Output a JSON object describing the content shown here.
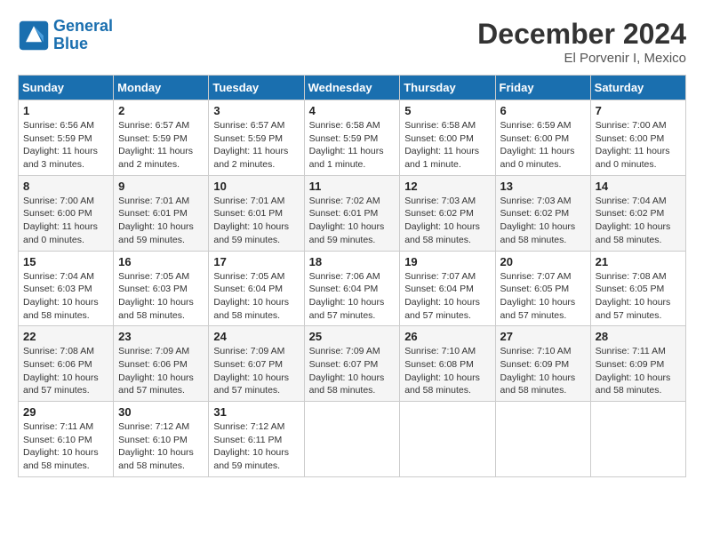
{
  "header": {
    "logo_line1": "General",
    "logo_line2": "Blue",
    "month_year": "December 2024",
    "location": "El Porvenir I, Mexico"
  },
  "weekdays": [
    "Sunday",
    "Monday",
    "Tuesday",
    "Wednesday",
    "Thursday",
    "Friday",
    "Saturday"
  ],
  "weeks": [
    [
      {
        "day": "1",
        "info": "Sunrise: 6:56 AM\nSunset: 5:59 PM\nDaylight: 11 hours\nand 3 minutes."
      },
      {
        "day": "2",
        "info": "Sunrise: 6:57 AM\nSunset: 5:59 PM\nDaylight: 11 hours\nand 2 minutes."
      },
      {
        "day": "3",
        "info": "Sunrise: 6:57 AM\nSunset: 5:59 PM\nDaylight: 11 hours\nand 2 minutes."
      },
      {
        "day": "4",
        "info": "Sunrise: 6:58 AM\nSunset: 5:59 PM\nDaylight: 11 hours\nand 1 minute."
      },
      {
        "day": "5",
        "info": "Sunrise: 6:58 AM\nSunset: 6:00 PM\nDaylight: 11 hours\nand 1 minute."
      },
      {
        "day": "6",
        "info": "Sunrise: 6:59 AM\nSunset: 6:00 PM\nDaylight: 11 hours\nand 0 minutes."
      },
      {
        "day": "7",
        "info": "Sunrise: 7:00 AM\nSunset: 6:00 PM\nDaylight: 11 hours\nand 0 minutes."
      }
    ],
    [
      {
        "day": "8",
        "info": "Sunrise: 7:00 AM\nSunset: 6:00 PM\nDaylight: 11 hours\nand 0 minutes."
      },
      {
        "day": "9",
        "info": "Sunrise: 7:01 AM\nSunset: 6:01 PM\nDaylight: 10 hours\nand 59 minutes."
      },
      {
        "day": "10",
        "info": "Sunrise: 7:01 AM\nSunset: 6:01 PM\nDaylight: 10 hours\nand 59 minutes."
      },
      {
        "day": "11",
        "info": "Sunrise: 7:02 AM\nSunset: 6:01 PM\nDaylight: 10 hours\nand 59 minutes."
      },
      {
        "day": "12",
        "info": "Sunrise: 7:03 AM\nSunset: 6:02 PM\nDaylight: 10 hours\nand 58 minutes."
      },
      {
        "day": "13",
        "info": "Sunrise: 7:03 AM\nSunset: 6:02 PM\nDaylight: 10 hours\nand 58 minutes."
      },
      {
        "day": "14",
        "info": "Sunrise: 7:04 AM\nSunset: 6:02 PM\nDaylight: 10 hours\nand 58 minutes."
      }
    ],
    [
      {
        "day": "15",
        "info": "Sunrise: 7:04 AM\nSunset: 6:03 PM\nDaylight: 10 hours\nand 58 minutes."
      },
      {
        "day": "16",
        "info": "Sunrise: 7:05 AM\nSunset: 6:03 PM\nDaylight: 10 hours\nand 58 minutes."
      },
      {
        "day": "17",
        "info": "Sunrise: 7:05 AM\nSunset: 6:04 PM\nDaylight: 10 hours\nand 58 minutes."
      },
      {
        "day": "18",
        "info": "Sunrise: 7:06 AM\nSunset: 6:04 PM\nDaylight: 10 hours\nand 57 minutes."
      },
      {
        "day": "19",
        "info": "Sunrise: 7:07 AM\nSunset: 6:04 PM\nDaylight: 10 hours\nand 57 minutes."
      },
      {
        "day": "20",
        "info": "Sunrise: 7:07 AM\nSunset: 6:05 PM\nDaylight: 10 hours\nand 57 minutes."
      },
      {
        "day": "21",
        "info": "Sunrise: 7:08 AM\nSunset: 6:05 PM\nDaylight: 10 hours\nand 57 minutes."
      }
    ],
    [
      {
        "day": "22",
        "info": "Sunrise: 7:08 AM\nSunset: 6:06 PM\nDaylight: 10 hours\nand 57 minutes."
      },
      {
        "day": "23",
        "info": "Sunrise: 7:09 AM\nSunset: 6:06 PM\nDaylight: 10 hours\nand 57 minutes."
      },
      {
        "day": "24",
        "info": "Sunrise: 7:09 AM\nSunset: 6:07 PM\nDaylight: 10 hours\nand 57 minutes."
      },
      {
        "day": "25",
        "info": "Sunrise: 7:09 AM\nSunset: 6:07 PM\nDaylight: 10 hours\nand 58 minutes."
      },
      {
        "day": "26",
        "info": "Sunrise: 7:10 AM\nSunset: 6:08 PM\nDaylight: 10 hours\nand 58 minutes."
      },
      {
        "day": "27",
        "info": "Sunrise: 7:10 AM\nSunset: 6:09 PM\nDaylight: 10 hours\nand 58 minutes."
      },
      {
        "day": "28",
        "info": "Sunrise: 7:11 AM\nSunset: 6:09 PM\nDaylight: 10 hours\nand 58 minutes."
      }
    ],
    [
      {
        "day": "29",
        "info": "Sunrise: 7:11 AM\nSunset: 6:10 PM\nDaylight: 10 hours\nand 58 minutes."
      },
      {
        "day": "30",
        "info": "Sunrise: 7:12 AM\nSunset: 6:10 PM\nDaylight: 10 hours\nand 58 minutes."
      },
      {
        "day": "31",
        "info": "Sunrise: 7:12 AM\nSunset: 6:11 PM\nDaylight: 10 hours\nand 59 minutes."
      },
      null,
      null,
      null,
      null
    ]
  ]
}
